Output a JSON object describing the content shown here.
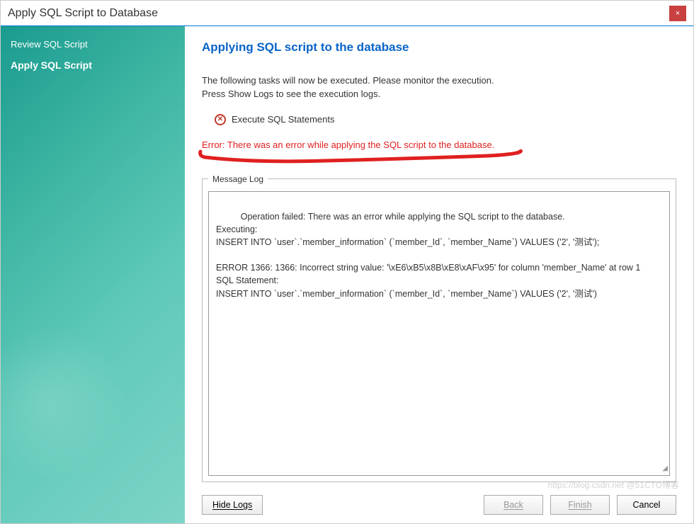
{
  "window": {
    "title": "Apply SQL Script to Database",
    "close_label": "×"
  },
  "sidebar": {
    "steps": [
      {
        "label": "Review SQL Script",
        "active": false
      },
      {
        "label": "Apply SQL Script",
        "active": true
      }
    ]
  },
  "main": {
    "heading": "Applying SQL script to the database",
    "intro_line1": "The following tasks will now be executed. Please monitor the execution.",
    "intro_line2": "Press Show Logs to see the execution logs.",
    "task": {
      "icon_symbol": "✕",
      "label": "Execute SQL Statements"
    },
    "error_text": "Error: There was an error while applying the SQL script to the database.",
    "message_log": {
      "legend": "Message Log",
      "content": "Operation failed: There was an error while applying the SQL script to the database.\nExecuting:\nINSERT INTO `user`.`member_information` (`member_Id`, `member_Name`) VALUES ('2', '测试');\n\nERROR 1366: 1366: Incorrect string value: '\\xE6\\xB5\\x8B\\xE8\\xAF\\x95' for column 'member_Name' at row 1\nSQL Statement:\nINSERT INTO `user`.`member_information` (`member_Id`, `member_Name`) VALUES ('2', '测试')"
    }
  },
  "buttons": {
    "hide_logs": "Hide Logs",
    "back": "Back",
    "finish": "Finish",
    "cancel": "Cancel"
  },
  "watermark": "https://blog.csdn.net @51CTO博客"
}
